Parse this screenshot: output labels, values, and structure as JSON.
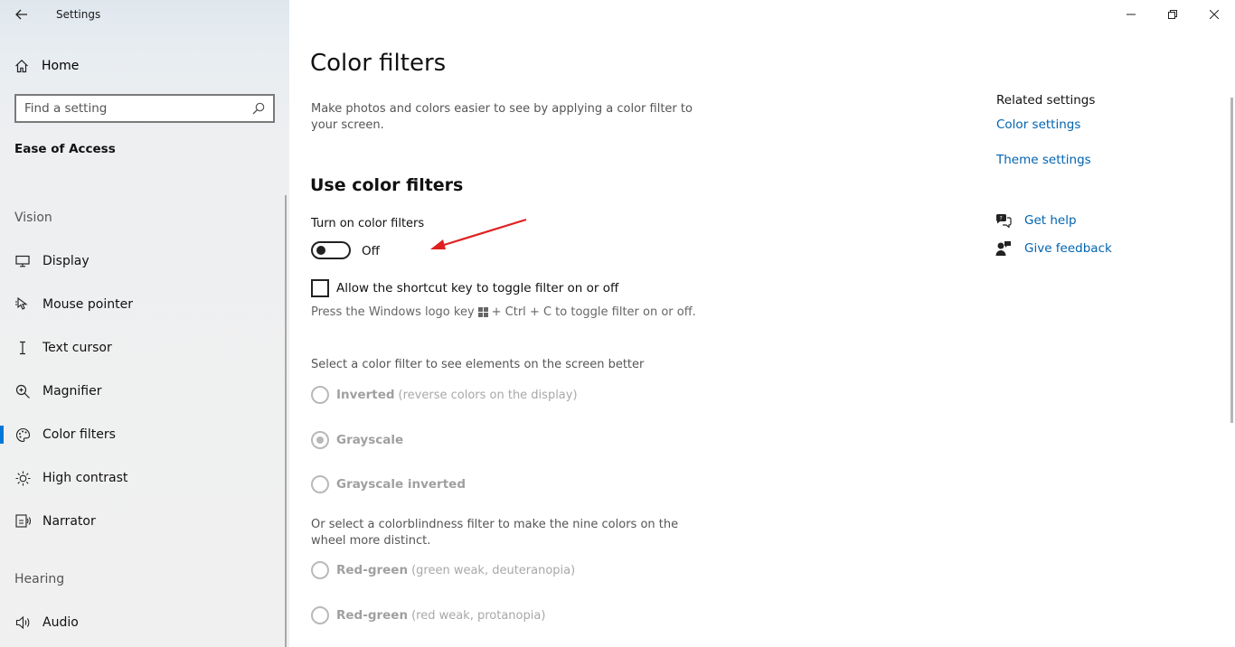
{
  "app": {
    "title": "Settings"
  },
  "window_controls": {
    "minimize": "minimize-icon",
    "restore": "restore-icon",
    "close": "close-icon"
  },
  "sidebar": {
    "home_label": "Home",
    "search": {
      "placeholder": "Find a setting"
    },
    "section_title": "Ease of Access",
    "groups": [
      {
        "label": "Vision",
        "items": [
          {
            "label": "Display",
            "icon": "monitor-icon"
          },
          {
            "label": "Mouse pointer",
            "icon": "mouse-pointer-icon"
          },
          {
            "label": "Text cursor",
            "icon": "text-cursor-icon"
          },
          {
            "label": "Magnifier",
            "icon": "magnifier-icon"
          },
          {
            "label": "Color filters",
            "icon": "palette-icon",
            "active": true
          },
          {
            "label": "High contrast",
            "icon": "sun-icon"
          },
          {
            "label": "Narrator",
            "icon": "narrator-icon"
          }
        ]
      },
      {
        "label": "Hearing",
        "items": [
          {
            "label": "Audio",
            "icon": "speaker-icon"
          }
        ]
      }
    ]
  },
  "main": {
    "title": "Color filters",
    "description": "Make photos and colors easier to see by applying a color filter to your screen.",
    "subheading": "Use color filters",
    "toggle": {
      "label": "Turn on color filters",
      "state": "Off"
    },
    "shortcut_checkbox": {
      "label": "Allow the shortcut key to toggle filter on or off",
      "checked": false
    },
    "shortcut_hint": {
      "before": "Press the Windows logo key",
      "after": "+ Ctrl + C to toggle filter on or off."
    },
    "filter_prompt": "Select a color filter to see elements on the screen better",
    "filters": [
      {
        "label": "Inverted",
        "detail": "(reverse colors on the display)",
        "checked": false
      },
      {
        "label": "Grayscale",
        "detail": "",
        "checked": true
      },
      {
        "label": "Grayscale inverted",
        "detail": "",
        "checked": false
      }
    ],
    "colorblind_prompt": "Or select a colorblindness filter to make the nine colors on the wheel more distinct.",
    "colorblind_filters": [
      {
        "label": "Red-green",
        "detail": "(green weak, deuteranopia)",
        "checked": false
      },
      {
        "label": "Red-green",
        "detail": "(red weak, protanopia)",
        "checked": false
      }
    ]
  },
  "related": {
    "title": "Related settings",
    "links": [
      "Color settings",
      "Theme settings"
    ],
    "help": {
      "label": "Get help",
      "icon": "help-chat-icon"
    },
    "feedback": {
      "label": "Give feedback",
      "icon": "feedback-icon"
    }
  },
  "colors": {
    "accent": "#0078d7",
    "link": "#0063b1",
    "annotation_arrow": "#e02020"
  }
}
